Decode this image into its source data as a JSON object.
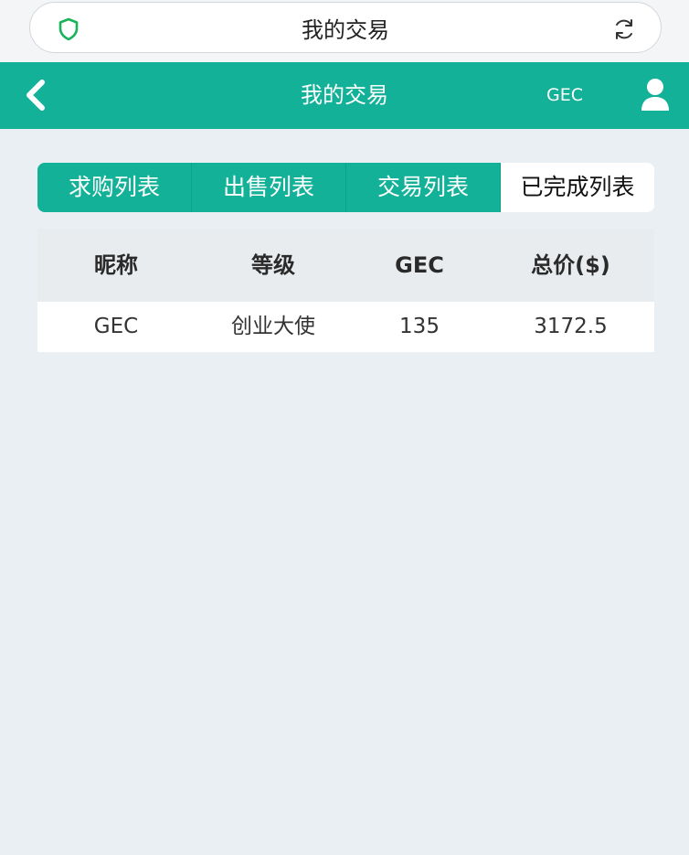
{
  "browser": {
    "title": "我的交易",
    "shield_icon": "shield-icon",
    "refresh_icon": "refresh-icon"
  },
  "header": {
    "title": "我的交易",
    "user_label": "GEC",
    "back_icon": "chevron-left-icon",
    "user_icon": "user-icon",
    "color": "#12b198"
  },
  "tabs": [
    {
      "label": "求购列表",
      "active": false
    },
    {
      "label": "出售列表",
      "active": false
    },
    {
      "label": "交易列表",
      "active": false
    },
    {
      "label": "已完成列表",
      "active": true
    }
  ],
  "table": {
    "headers": [
      "昵称",
      "等级",
      "GEC",
      "总价($)"
    ],
    "rows": [
      [
        "GEC",
        "创业大使",
        "135",
        "3172.5"
      ]
    ]
  }
}
